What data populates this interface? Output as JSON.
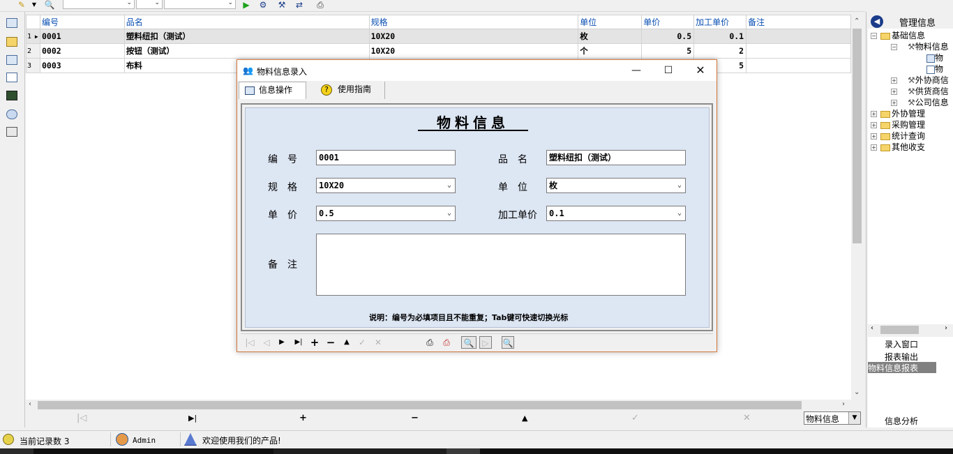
{
  "grid": {
    "columns": [
      "编号",
      "品名",
      "规格",
      "单位",
      "单价",
      "加工单价",
      "备注"
    ],
    "rows": [
      {
        "row_no": "1",
        "code": "0001",
        "name": "塑料纽扣（测试）",
        "spec": "10X20",
        "unit": "枚",
        "price": "0.5",
        "proc_price": "0.1",
        "note": ""
      },
      {
        "row_no": "2",
        "code": "0002",
        "name": "按钮（测试）",
        "spec": "10X20",
        "unit": "个",
        "price": "5",
        "proc_price": "2",
        "note": ""
      },
      {
        "row_no": "3",
        "code": "0003",
        "name": "布料",
        "spec": "",
        "unit": "",
        "price": "",
        "proc_price": "5",
        "note": ""
      }
    ]
  },
  "bottom_nav": {
    "select_value": "物料信息"
  },
  "right_panel": {
    "header": "管理信息",
    "tree": {
      "basic": "基础信息",
      "material": "物料信息",
      "leaf1": "物",
      "leaf2": "物",
      "outsource": "外协商信",
      "supplier": "供货商信",
      "company": "公司信息",
      "outsource_mgmt": "外协管理",
      "purchase_mgmt": "采购管理",
      "stats": "统计查询",
      "other": "其他收支"
    },
    "items": {
      "entry_window": "录入窗口",
      "report_output": "报表输出",
      "material_report": "物料信息报表",
      "analysis": "信息分析"
    }
  },
  "status": {
    "record_count": "当前记录数 3",
    "user": "Admin",
    "welcome": "欢迎使用我们的产品!"
  },
  "dialog": {
    "title": "物料信息录入",
    "tabs": {
      "info_ops": "信息操作",
      "guide": "使用指南"
    },
    "heading": "物料信息",
    "labels": {
      "code": "编　号",
      "name": "品　名",
      "spec": "规　格",
      "unit": "单　位",
      "price": "单　价",
      "proc_price": "加工单价",
      "note": "备　注"
    },
    "values": {
      "code": "0001",
      "name": "塑料纽扣（测试）",
      "spec": "10X20",
      "unit": "枚",
      "price": "0.5",
      "proc_price": "0.1",
      "note": ""
    },
    "hint": "说明：编号为必填项目且不能重复；Tab键可快速切换光标"
  },
  "colors": {
    "dialog_border": "#d2763c",
    "form_bg": "#dde6f3",
    "header_text": "#0a4fb3",
    "selected_tree": "#808080"
  }
}
